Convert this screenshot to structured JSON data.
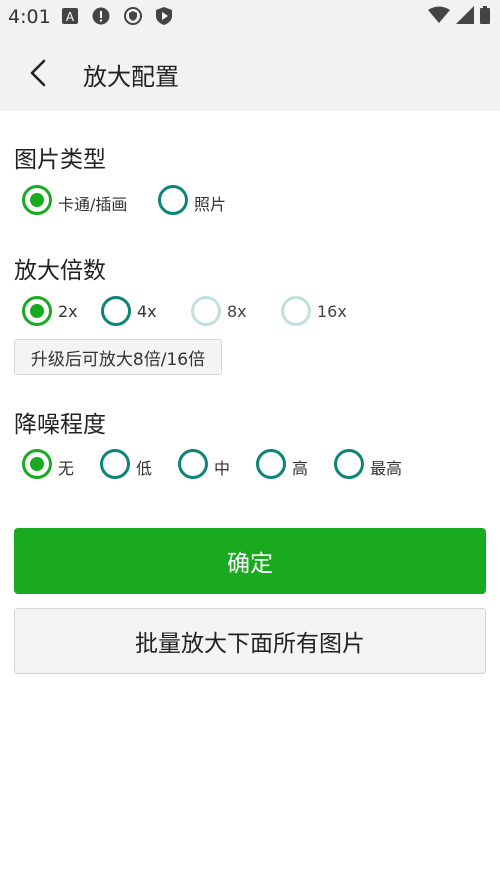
{
  "status_bar": {
    "time": "4:01",
    "left_icons": [
      "font-a-icon",
      "alert-icon",
      "shield-badge-icon",
      "play-protect-icon"
    ],
    "right_icons": [
      "wifi-icon",
      "cell-signal-icon",
      "battery-icon"
    ]
  },
  "header": {
    "title": "放大配置",
    "back_icon": "chevron-left-icon"
  },
  "image_type": {
    "title": "图片类型",
    "options": [
      {
        "label": "卡通/插画",
        "checked": true
      },
      {
        "label": "照片",
        "checked": false
      }
    ]
  },
  "scale": {
    "title": "放大倍数",
    "options": [
      {
        "label": "2x",
        "checked": true
      },
      {
        "label": "4x",
        "checked": false
      },
      {
        "label": "8x",
        "checked": false,
        "disabled": true
      },
      {
        "label": "16x",
        "checked": false,
        "disabled": true
      }
    ],
    "upgrade_hint": "升级后可放大8倍/16倍"
  },
  "denoise": {
    "title": "降噪程度",
    "options": [
      {
        "label": "无",
        "checked": true
      },
      {
        "label": "低",
        "checked": false
      },
      {
        "label": "中",
        "checked": false
      },
      {
        "label": "高",
        "checked": false
      },
      {
        "label": "最高",
        "checked": false
      }
    ]
  },
  "actions": {
    "confirm_label": "确定",
    "batch_label": "批量放大下面所有图片"
  },
  "colors": {
    "accent": "#1aaa1f",
    "radio_unchecked": "#0e8478",
    "radio_disabled": "#bfe0dd"
  }
}
